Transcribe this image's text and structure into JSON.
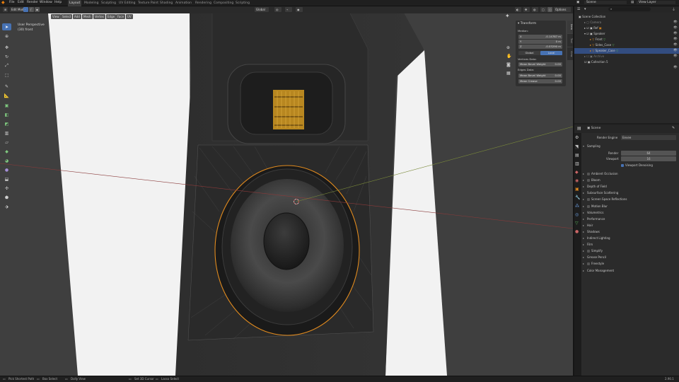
{
  "menu": [
    "File",
    "Edit",
    "Render",
    "Window",
    "Help"
  ],
  "workspaces": [
    {
      "label": "Layout",
      "active": true
    },
    {
      "label": "Modeling",
      "active": false
    },
    {
      "label": "Sculpting",
      "active": false
    },
    {
      "label": "UV Editing",
      "active": false
    },
    {
      "label": "Texture Paint",
      "active": false
    },
    {
      "label": "Shading",
      "active": false
    },
    {
      "label": "Animation",
      "active": false
    },
    {
      "label": "Rendering",
      "active": false
    },
    {
      "label": "Compositing",
      "active": false
    },
    {
      "label": "Scripting",
      "active": false
    }
  ],
  "top_right": {
    "scene": "Scene",
    "view_layer": "View Layer"
  },
  "viewport_header": {
    "mode": "Edit Mode",
    "menus": [
      "View",
      "Select",
      "Add",
      "Mesh",
      "Vertex",
      "Edge",
      "Face",
      "UV"
    ],
    "transform_orientation": "Global",
    "options": "Options"
  },
  "overlay_text": {
    "view_name": "User Perspective",
    "object_name": "(30) front"
  },
  "npanel": {
    "title": "Transform",
    "median_label": "Median:",
    "x_label": "X",
    "x_value": "-0.14787 m",
    "y_label": "Y",
    "y_value": "0 m",
    "z_label": "Z",
    "z_value": "-0.03290 m",
    "global_label": "Global",
    "local_label": "Local",
    "vertices_data_label": "Vertices Data:",
    "mean_bevel_weight_label_v": "Mean Bevel Weight",
    "mean_bevel_weight_v": "0.00",
    "edges_data_label": "Edges Data:",
    "mean_bevel_weight_label_e": "Mean Bevel Weight",
    "mean_bevel_weight_e": "0.00",
    "mean_crease_label": "Mean Crease",
    "mean_crease": "0.00",
    "tabs": [
      "Item",
      "Tool",
      "View"
    ]
  },
  "outliner": {
    "rows": [
      {
        "label": "Scene Collection",
        "indent": 0,
        "selected": false
      },
      {
        "label": "Camera",
        "indent": 1,
        "selected": false
      },
      {
        "label": "Ref",
        "indent": 1,
        "selected": false
      },
      {
        "label": "Speaker",
        "indent": 1,
        "selected": false
      },
      {
        "label": "Front",
        "indent": 2,
        "selected": false
      },
      {
        "label": "Sides_Case",
        "indent": 2,
        "selected": false
      },
      {
        "label": "Speaker_Case",
        "indent": 2,
        "selected": true
      },
      {
        "label": "Archive",
        "indent": 1,
        "selected": false
      },
      {
        "label": "Collection 5",
        "indent": 1,
        "selected": false
      }
    ]
  },
  "properties": {
    "scene_name": "Scene",
    "render_engine_label": "Render Engine",
    "render_engine": "Eevee",
    "sampling_label": "Sampling",
    "render_label": "Render",
    "render_value": "64",
    "viewport_label": "Viewport",
    "viewport_value": "16",
    "viewport_denoising": "Viewport Denoising",
    "sections": [
      {
        "label": "Ambient Occlusion",
        "checkbox": true
      },
      {
        "label": "Bloom",
        "checkbox": true
      },
      {
        "label": "Depth of Field",
        "checkbox": false
      },
      {
        "label": "Subsurface Scattering",
        "checkbox": false
      },
      {
        "label": "Screen Space Reflections",
        "checkbox": true
      },
      {
        "label": "Motion Blur",
        "checkbox": true
      },
      {
        "label": "Volumetrics",
        "checkbox": false
      },
      {
        "label": "Performance",
        "checkbox": false
      },
      {
        "label": "Hair",
        "checkbox": false
      },
      {
        "label": "Shadows",
        "checkbox": false
      },
      {
        "label": "Indirect Lighting",
        "checkbox": false
      },
      {
        "label": "Film",
        "checkbox": false
      },
      {
        "label": "Simplify",
        "checkbox": true
      },
      {
        "label": "Grease Pencil",
        "checkbox": false
      },
      {
        "label": "Freestyle",
        "checkbox": true
      },
      {
        "label": "Color Management",
        "checkbox": false
      }
    ]
  },
  "statusbar": {
    "item1": "Pick Shortest Path",
    "item2": "Box Select",
    "item3": "Dolly View",
    "item4": "Set 3D Cursor",
    "item5": "Lasso Select",
    "version": "2.90.1"
  },
  "colors": {
    "accent": "#4772b3",
    "selection_orange": "#e08a1e"
  }
}
